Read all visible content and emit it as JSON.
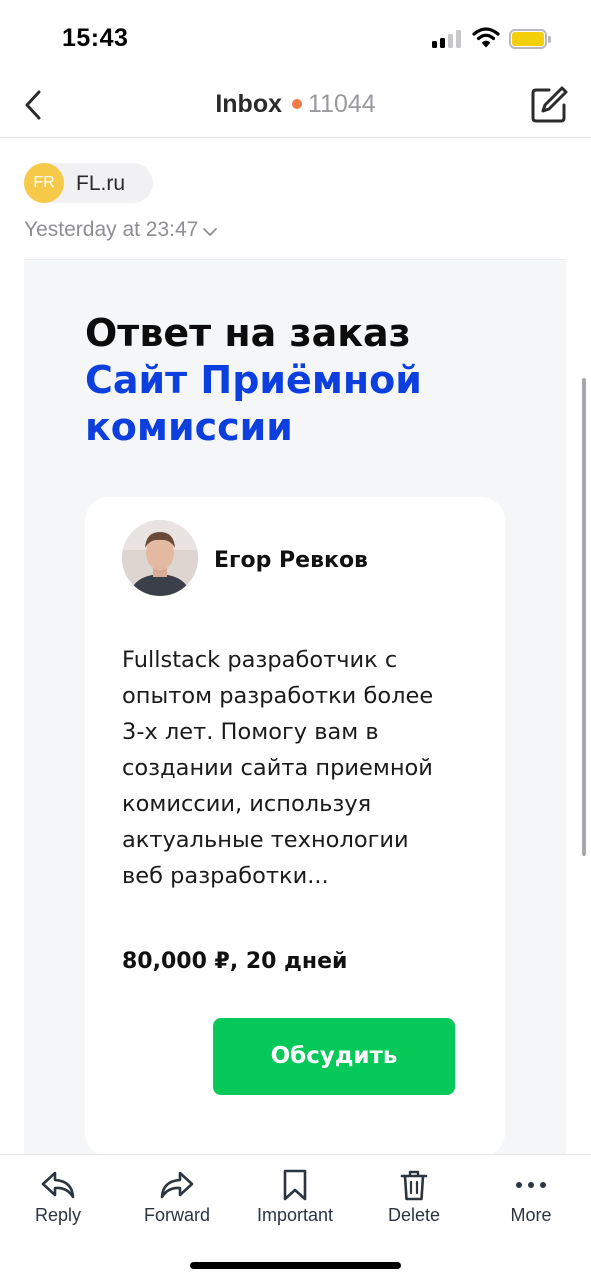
{
  "status_bar": {
    "time": "15:43",
    "icons": [
      "signal-icon",
      "wifi-icon",
      "battery-icon"
    ],
    "battery_color": "#f6cf0c"
  },
  "nav": {
    "back_icon": "chevron-left-icon",
    "title": "Inbox",
    "unread_dot_color": "#f37a48",
    "count": "11044",
    "compose_icon": "compose-icon"
  },
  "email": {
    "sender": {
      "initials": "FR",
      "name": "FL.ru",
      "avatar_color": "#f7c948"
    },
    "date": "Yesterday at 23:47",
    "content": {
      "headline": "Ответ на заказ",
      "project_link": "Сайт Приёмной комиссии",
      "link_color": "#0c3fde",
      "card": {
        "name": "Егор Ревков",
        "text": "Fullstack разработчик с опытом разработки более 3-х лет. Помогу вам в создании сайта приемной комиссии, используя актуальные технологии веб разработки...",
        "price": "80,000 ₽, 20 дней",
        "button": "Обсудить",
        "button_color": "#06c95a"
      }
    }
  },
  "toolbar": {
    "items": [
      {
        "label": "Reply",
        "icon": "reply-icon"
      },
      {
        "label": "Forward",
        "icon": "forward-icon"
      },
      {
        "label": "Important",
        "icon": "bookmark-icon"
      },
      {
        "label": "Delete",
        "icon": "trash-icon"
      },
      {
        "label": "More",
        "icon": "more-icon"
      }
    ]
  }
}
